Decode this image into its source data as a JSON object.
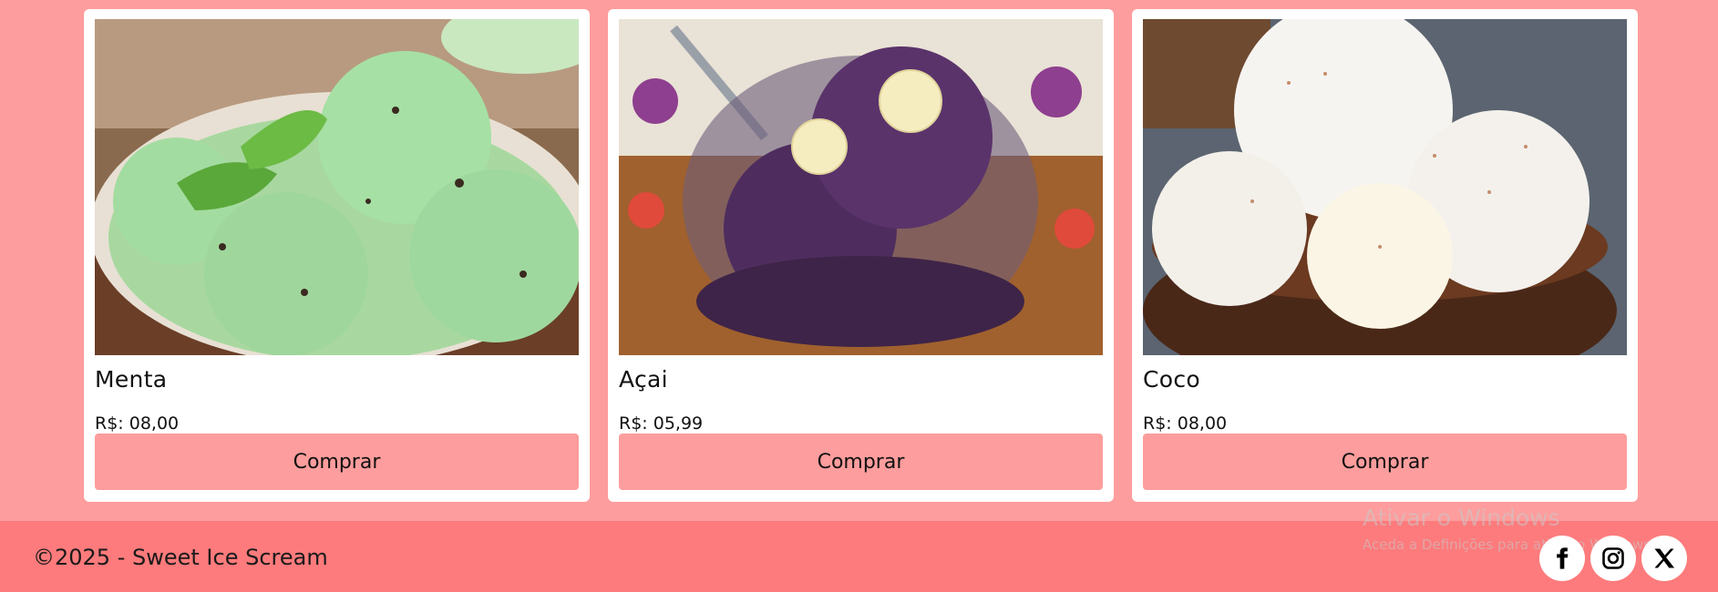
{
  "products": [
    {
      "name": "Menta",
      "price": "R$: 08,00",
      "button": "Comprar",
      "image": "mint-ice-cream-bowl"
    },
    {
      "name": "Açai",
      "price": "R$: 05,99",
      "button": "Comprar",
      "image": "acai-bowl-with-banana"
    },
    {
      "name": "Coco",
      "price": "R$: 08,00",
      "button": "Comprar",
      "image": "coconut-ice-cream-bowl"
    }
  ],
  "footer": {
    "copyright": "©2025 - Sweet Ice Scream",
    "social": [
      "facebook-icon",
      "instagram-icon",
      "x-icon"
    ]
  },
  "watermark": {
    "title": "Ativar o Windows",
    "subtitle": "Aceda a Definições para ativar o Windows."
  },
  "colors": {
    "page_background": "#fd9d9d",
    "footer_background": "#fd7b7c",
    "button_background": "#fd9d9d",
    "card_background": "#ffffff"
  }
}
